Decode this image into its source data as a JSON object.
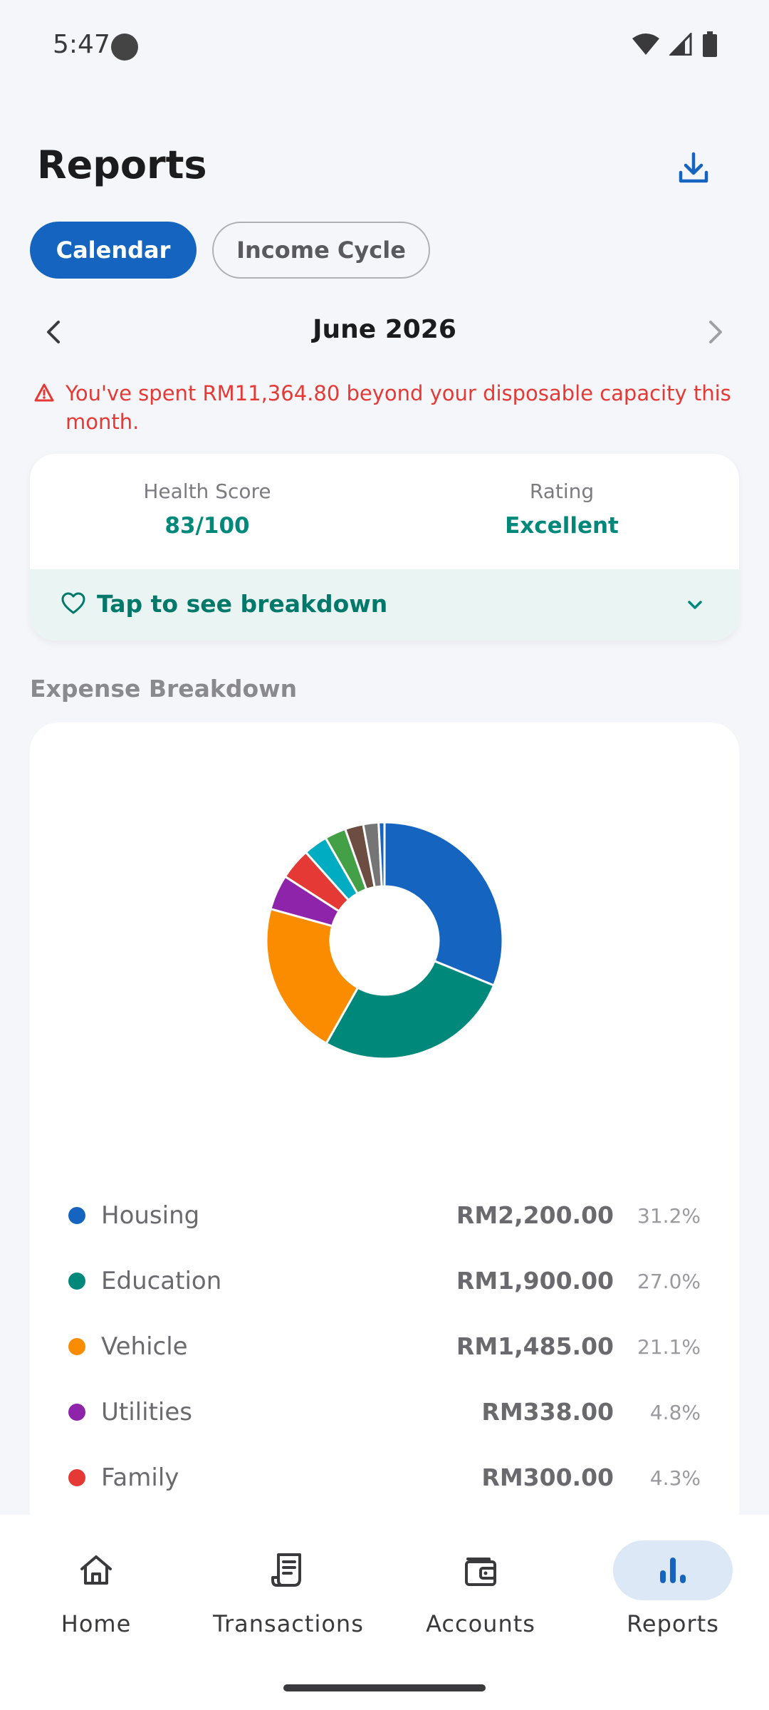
{
  "status": {
    "time": "5:47"
  },
  "header": {
    "title": "Reports",
    "download_icon": "download-icon"
  },
  "tabs": [
    {
      "label": "Calendar",
      "active": true
    },
    {
      "label": "Income Cycle",
      "active": false
    }
  ],
  "period": {
    "label": "June 2026"
  },
  "warning": {
    "text": "You've spent RM11,364.80 beyond your disposable capacity this month."
  },
  "health": {
    "score_label": "Health Score",
    "score_value": "83/100",
    "rating_label": "Rating",
    "rating_value": "Excellent",
    "breakdown_label": "Tap to see breakdown"
  },
  "expense": {
    "section_title": "Expense Breakdown"
  },
  "chart_data": {
    "type": "pie",
    "donut": true,
    "slices": [
      {
        "name": "Housing",
        "value": 31.2,
        "color": "#1565c0"
      },
      {
        "name": "Education",
        "value": 27.0,
        "color": "#00897b"
      },
      {
        "name": "Vehicle",
        "value": 21.1,
        "color": "#fb8c00"
      },
      {
        "name": "Utilities",
        "value": 4.8,
        "color": "#8e24aa"
      },
      {
        "name": "Family",
        "value": 4.3,
        "color": "#e53935"
      },
      {
        "value": 3.3,
        "color": "#00acc1"
      },
      {
        "value": 2.9,
        "color": "#43a047"
      },
      {
        "value": 2.5,
        "color": "#6d4c41"
      },
      {
        "value": 2.1,
        "color": "#757575"
      },
      {
        "value": 0.8,
        "color": "#1565c0"
      }
    ]
  },
  "legend": [
    {
      "name": "Housing",
      "amount": "RM2,200.00",
      "pct": "31.2%",
      "color": "#1565c0"
    },
    {
      "name": "Education",
      "amount": "RM1,900.00",
      "pct": "27.0%",
      "color": "#00897b"
    },
    {
      "name": "Vehicle",
      "amount": "RM1,485.00",
      "pct": "21.1%",
      "color": "#fb8c00"
    },
    {
      "name": "Utilities",
      "amount": "RM338.00",
      "pct": "4.8%",
      "color": "#8e24aa"
    },
    {
      "name": "Family",
      "amount": "RM300.00",
      "pct": "4.3%",
      "color": "#e53935"
    }
  ],
  "nav": [
    {
      "label": "Home",
      "icon": "home-icon",
      "active": false
    },
    {
      "label": "Transactions",
      "icon": "receipt-icon",
      "active": false
    },
    {
      "label": "Accounts",
      "icon": "wallet-icon",
      "active": false
    },
    {
      "label": "Reports",
      "icon": "bar-chart-icon",
      "active": true
    }
  ]
}
